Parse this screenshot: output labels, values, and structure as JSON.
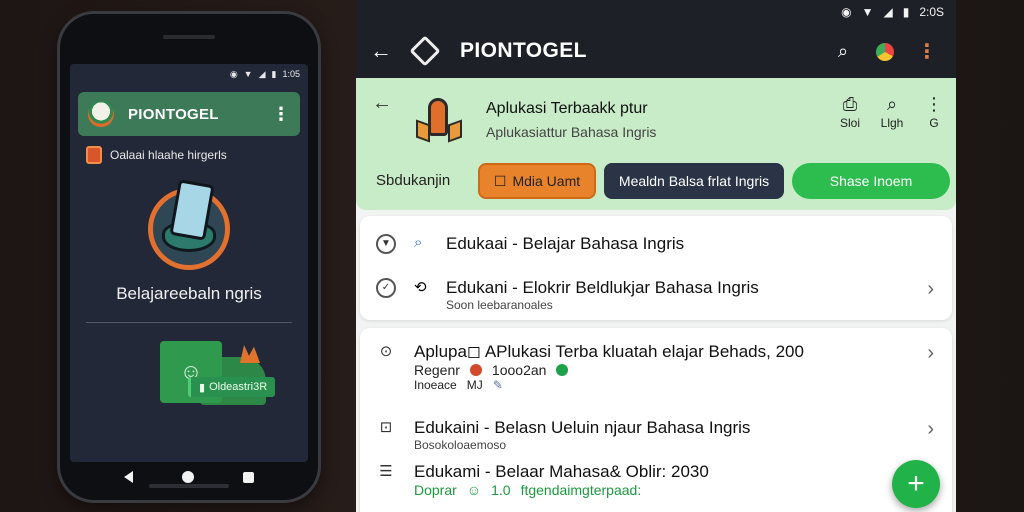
{
  "phone": {
    "status_time": "1:05",
    "status_icons": [
      "location-icon",
      "wifi-icon",
      "signal-icon",
      "battery-icon"
    ],
    "app_title": "PIONTOGEL",
    "more_glyph": "⋮",
    "subline_text": "Oalaai hlaahe hirgerls",
    "illustration_caption": "Belajareebaln ngris",
    "pill_text": "Oldeastri3R",
    "pill_icon": "▮"
  },
  "app": {
    "status_time": "2:0S",
    "topbar": {
      "title": "PIONTOGEL",
      "back_glyph": "←",
      "search_glyph": "⌕",
      "more_glyph": "⋮"
    },
    "header": {
      "title": "Aplukasi Terbaakk ptur",
      "subtitle": "Aplukasiattur Bahasa Ingris",
      "back_glyph": "←",
      "actions": [
        {
          "glyph": "⎙",
          "label": "Sloi"
        },
        {
          "glyph": "⌕",
          "label": "Llgh"
        },
        {
          "glyph": "⋮",
          "label": "G"
        }
      ],
      "category": "Sbdukanjin",
      "chips": [
        {
          "label": "Mdia Uamt",
          "icon": "☐"
        },
        {
          "label": "Mealdn Balsa frlat Ingris"
        },
        {
          "label": "Shase Inoem"
        }
      ]
    },
    "card1": [
      {
        "icon": "⌕",
        "title": "Edukaai - Belajar Bahasa Ingris"
      },
      {
        "icon": "⟲",
        "title": "Edukani - Elokrir Beldlukjar Bahasa Ingris",
        "sub": "Soon leebaranoales"
      }
    ],
    "card2": [
      {
        "icon": "⊙",
        "title": "Aplupa◻ APlukasi Terba kluatah elajar Behads, 200",
        "meta1_label": "Regenr",
        "meta1_value": "1ooo2an",
        "meta2_label": "Inoeace",
        "meta2_value": "MJ"
      },
      {
        "icon": "⊡",
        "title": "Edukaini - Belasn Ueluin njaur Bahasa Ingris",
        "sub": "Bosokoloaemoso"
      },
      {
        "icon": "☰",
        "title": "Edukami - Belaar Mahasa& Oblir: 2030",
        "meta1_label": "Doprar",
        "meta1_value": "1.0",
        "meta_text": "ftgendaimgterpaad:"
      }
    ],
    "fab_glyph": "+"
  },
  "colors": {
    "accent_green": "#2dbd4f",
    "header_green": "#c8ebc8",
    "chip_orange": "#e8832c",
    "chip_dark": "#2a3446",
    "topbar": "#1d2027"
  }
}
